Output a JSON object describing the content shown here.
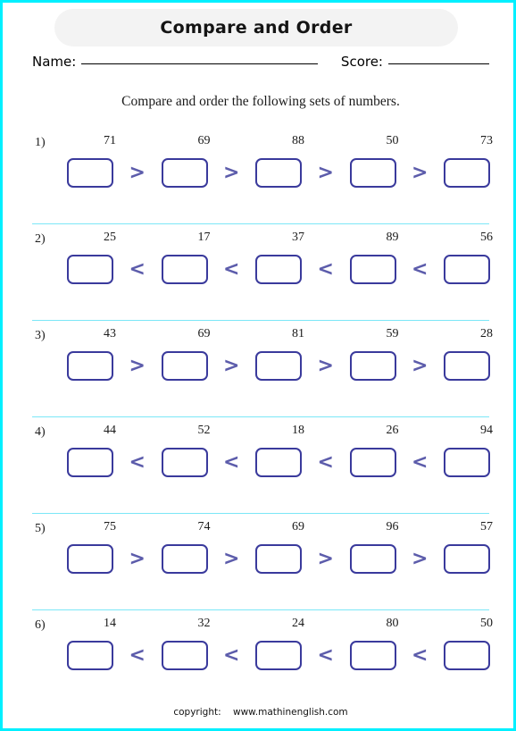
{
  "page": {
    "border_color": "#00f0ff",
    "title": "Compare and Order",
    "instruction": "Compare and order the following sets of numbers."
  },
  "header": {
    "name_label": "Name:",
    "score_label": "Score:"
  },
  "footer": {
    "copyright_label": "copyright:",
    "site": "www.mathinenglish.com"
  },
  "style": {
    "box_border_color": "#3a3a9c",
    "operator_color": "#5c5cab",
    "separator_color": "#7ce7f7",
    "title_pill_color": "#f3f3f3"
  },
  "problems": [
    {
      "index": "1)",
      "numbers": [
        "71",
        "69",
        "88",
        "50",
        "73"
      ],
      "operators": [
        ">",
        ">",
        ">",
        ">"
      ],
      "answers": [
        "",
        "",
        "",
        "",
        ""
      ]
    },
    {
      "index": "2)",
      "numbers": [
        "25",
        "17",
        "37",
        "89",
        "56"
      ],
      "operators": [
        "<",
        "<",
        "<",
        "<"
      ],
      "answers": [
        "",
        "",
        "",
        "",
        ""
      ]
    },
    {
      "index": "3)",
      "numbers": [
        "43",
        "69",
        "81",
        "59",
        "28"
      ],
      "operators": [
        ">",
        ">",
        ">",
        ">"
      ],
      "answers": [
        "",
        "",
        "",
        "",
        ""
      ]
    },
    {
      "index": "4)",
      "numbers": [
        "44",
        "52",
        "18",
        "26",
        "94"
      ],
      "operators": [
        "<",
        "<",
        "<",
        "<"
      ],
      "answers": [
        "",
        "",
        "",
        "",
        ""
      ]
    },
    {
      "index": "5)",
      "numbers": [
        "75",
        "74",
        "69",
        "96",
        "57"
      ],
      "operators": [
        ">",
        ">",
        ">",
        ">"
      ],
      "answers": [
        "",
        "",
        "",
        "",
        ""
      ]
    },
    {
      "index": "6)",
      "numbers": [
        "14",
        "32",
        "24",
        "80",
        "50"
      ],
      "operators": [
        "<",
        "<",
        "<",
        "<"
      ],
      "answers": [
        "",
        "",
        "",
        "",
        ""
      ]
    }
  ]
}
